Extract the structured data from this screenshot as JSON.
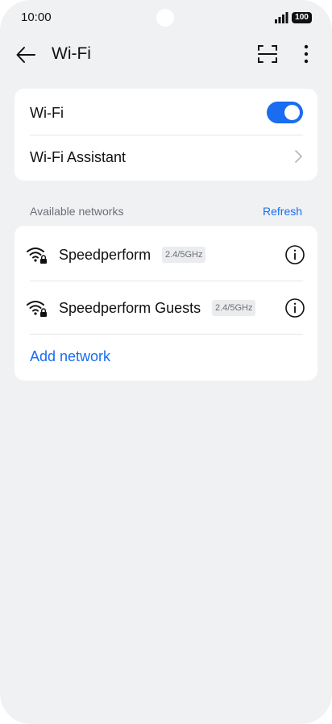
{
  "status_bar": {
    "time": "10:00",
    "battery": "100"
  },
  "header": {
    "title": "Wi-Fi",
    "icons": [
      "back-arrow-icon",
      "scan-qr-icon",
      "more-vertical-icon"
    ]
  },
  "settings": {
    "wifi_label": "Wi-Fi",
    "wifi_enabled": true,
    "assistant_label": "Wi-Fi Assistant"
  },
  "networks_section": {
    "label": "Available networks",
    "refresh_label": "Refresh",
    "networks": [
      {
        "name": "Speedperform",
        "band": "2.4/5GHz",
        "secured": true
      },
      {
        "name": "Speedperform Guests",
        "band": "2.4/5GHz",
        "secured": true
      }
    ],
    "add_network_label": "Add network"
  },
  "colors": {
    "accent": "#1a6cf0",
    "background": "#f0f1f3",
    "card": "#ffffff"
  }
}
